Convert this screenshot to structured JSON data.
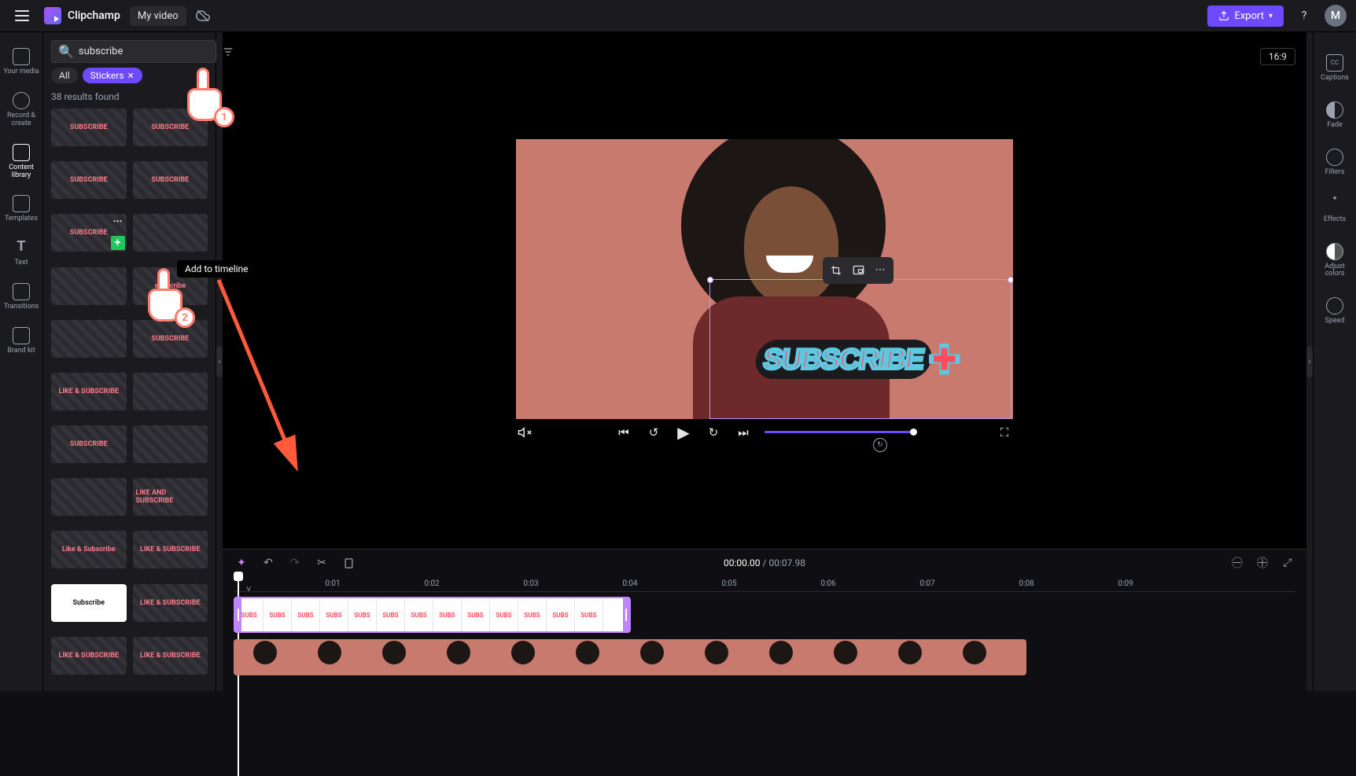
{
  "topbar": {
    "app_name": "Clipchamp",
    "project_name": "My video",
    "export_label": "Export",
    "help_glyph": "?",
    "avatar_initial": "M"
  },
  "left_rail": [
    {
      "label": "Your media"
    },
    {
      "label": "Record & create"
    },
    {
      "label": "Content library"
    },
    {
      "label": "Templates"
    },
    {
      "label": "Text"
    },
    {
      "label": "Transitions"
    },
    {
      "label": "Brand kit"
    }
  ],
  "library": {
    "search_value": "subscribe",
    "chips": {
      "all": "All",
      "stickers": "Stickers"
    },
    "results": "38 results found",
    "tooltip": "Add to timeline",
    "items": [
      "SUBSCRIBE",
      "SUBSCRIBE",
      "SUBSCRIBE",
      "SUBSCRIBE",
      "SUBSCRIBE",
      "",
      "",
      "subscribe",
      "",
      "SUBSCRIBE",
      "LIKE & SUBSCRIBE",
      "",
      "SUBSCRIBE",
      "",
      "",
      "LIKE AND SUBSCRIBE",
      "Like & Subscribe",
      "LIKE & SUBSCRIBE",
      "Subscribe",
      "LIKE & SUBSCRIBE",
      "LIKE & SUBSCRIBE",
      "LIKE & SUBSCRIBE"
    ]
  },
  "stage": {
    "aspect": "16:9",
    "sticker_text": "SUBSCRIBE"
  },
  "right_rail": [
    {
      "label": "Captions"
    },
    {
      "label": "Fade"
    },
    {
      "label": "Filters"
    },
    {
      "label": "Effects"
    },
    {
      "label": "Adjust colors"
    },
    {
      "label": "Speed"
    }
  ],
  "timeline": {
    "current": "00:00.00",
    "separator": " / ",
    "total": "00:07.98",
    "ticks": [
      "0:01",
      "0:02",
      "0:03",
      "0:04",
      "0:05",
      "0:06",
      "0:07",
      "0:08",
      "0:09"
    ]
  },
  "annotations": {
    "pointer1": "1",
    "pointer2": "2"
  }
}
